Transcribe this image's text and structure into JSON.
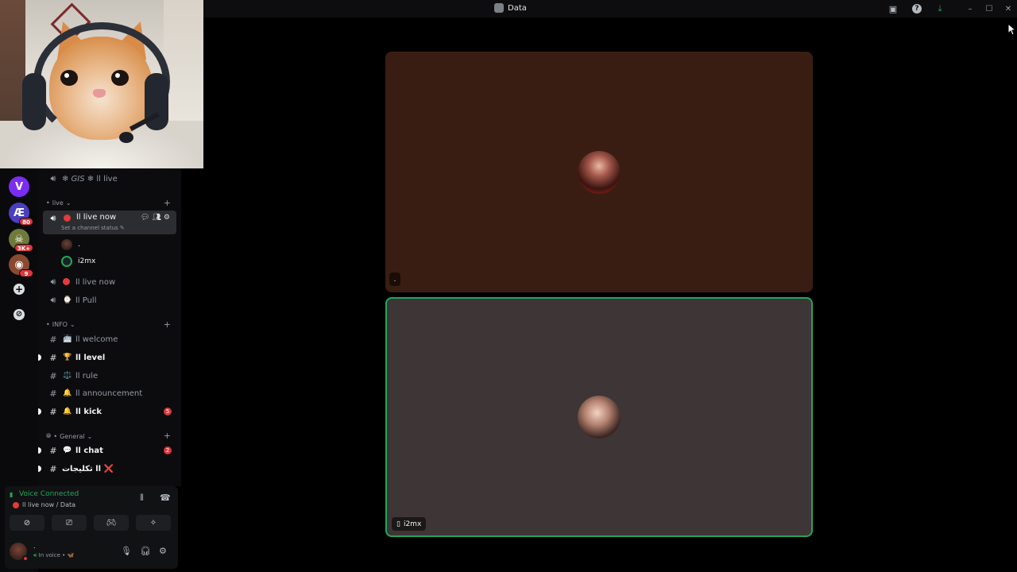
{
  "window": {
    "title": "Data",
    "icons": [
      "inbox-icon",
      "help-icon",
      "download-icon",
      "minimize-icon",
      "maximize-icon",
      "close-icon"
    ]
  },
  "server_rail": {
    "servers": [
      {
        "name": "server-v",
        "glyph": "V",
        "color": "#7b2cf2",
        "badge": ""
      },
      {
        "name": "server-ae",
        "glyph": "Æ",
        "color": "#4a3fbf",
        "badge": "80"
      },
      {
        "name": "server-3k",
        "glyph": "☠",
        "color": "#6f7a3a",
        "badge": "3K+"
      },
      {
        "name": "server-photo",
        "glyph": "◉",
        "color": "#8a4a2f",
        "badge": "9"
      }
    ],
    "add_glyph": "+",
    "explore_glyph": "⊘"
  },
  "channels": {
    "top_channel": {
      "prefix": "❄ GIS ❄",
      "label": "اا live"
    },
    "category_live": "live",
    "active_channel": {
      "label": "اا live now",
      "status": "Set a channel status"
    },
    "members": [
      {
        "name": "."
      },
      {
        "name": "i2mx"
      }
    ],
    "voice_channels": [
      {
        "emoji": "🔴",
        "label": "اا live now"
      },
      {
        "emoji": "⌚",
        "label": "اا Pull"
      }
    ],
    "category_info": "INFO",
    "info_channels": [
      {
        "emoji": "🚈",
        "label": "اا welcome",
        "bold": false,
        "badge": ""
      },
      {
        "emoji": "🏆",
        "label": "اا level",
        "bold": true,
        "badge": ""
      },
      {
        "emoji": "⚖️",
        "label": "اا rule",
        "bold": false,
        "badge": ""
      },
      {
        "emoji": "🔔",
        "label": "اا announcement",
        "bold": false,
        "badge": ""
      },
      {
        "emoji": "🔔",
        "label": "اا kick",
        "bold": true,
        "badge": "5"
      }
    ],
    "category_general": "General",
    "general_channels": [
      {
        "emoji": "💬",
        "label": "اا chat",
        "bold": true,
        "badge": "2"
      },
      {
        "emoji": "",
        "label": "اا تكليجات ❌",
        "bold": true,
        "badge": ""
      }
    ]
  },
  "voice_panel": {
    "status": "Voice Connected",
    "subtitle": "اا live now / Data",
    "buttons": [
      "camera-off-icon",
      "screen-share-icon",
      "activity-icon",
      "soundboard-icon"
    ]
  },
  "user": {
    "name": ".",
    "subtitle": "In voice • 🦋"
  },
  "stage": {
    "top_tile_tag": ".",
    "bottom_tile_tag": "i2mx"
  },
  "colors": {
    "accent_green": "#23a55a",
    "danger_red": "#da373c",
    "top_tile_bg": "#3a1d12",
    "bottom_tile_bg": "#3d3536"
  }
}
